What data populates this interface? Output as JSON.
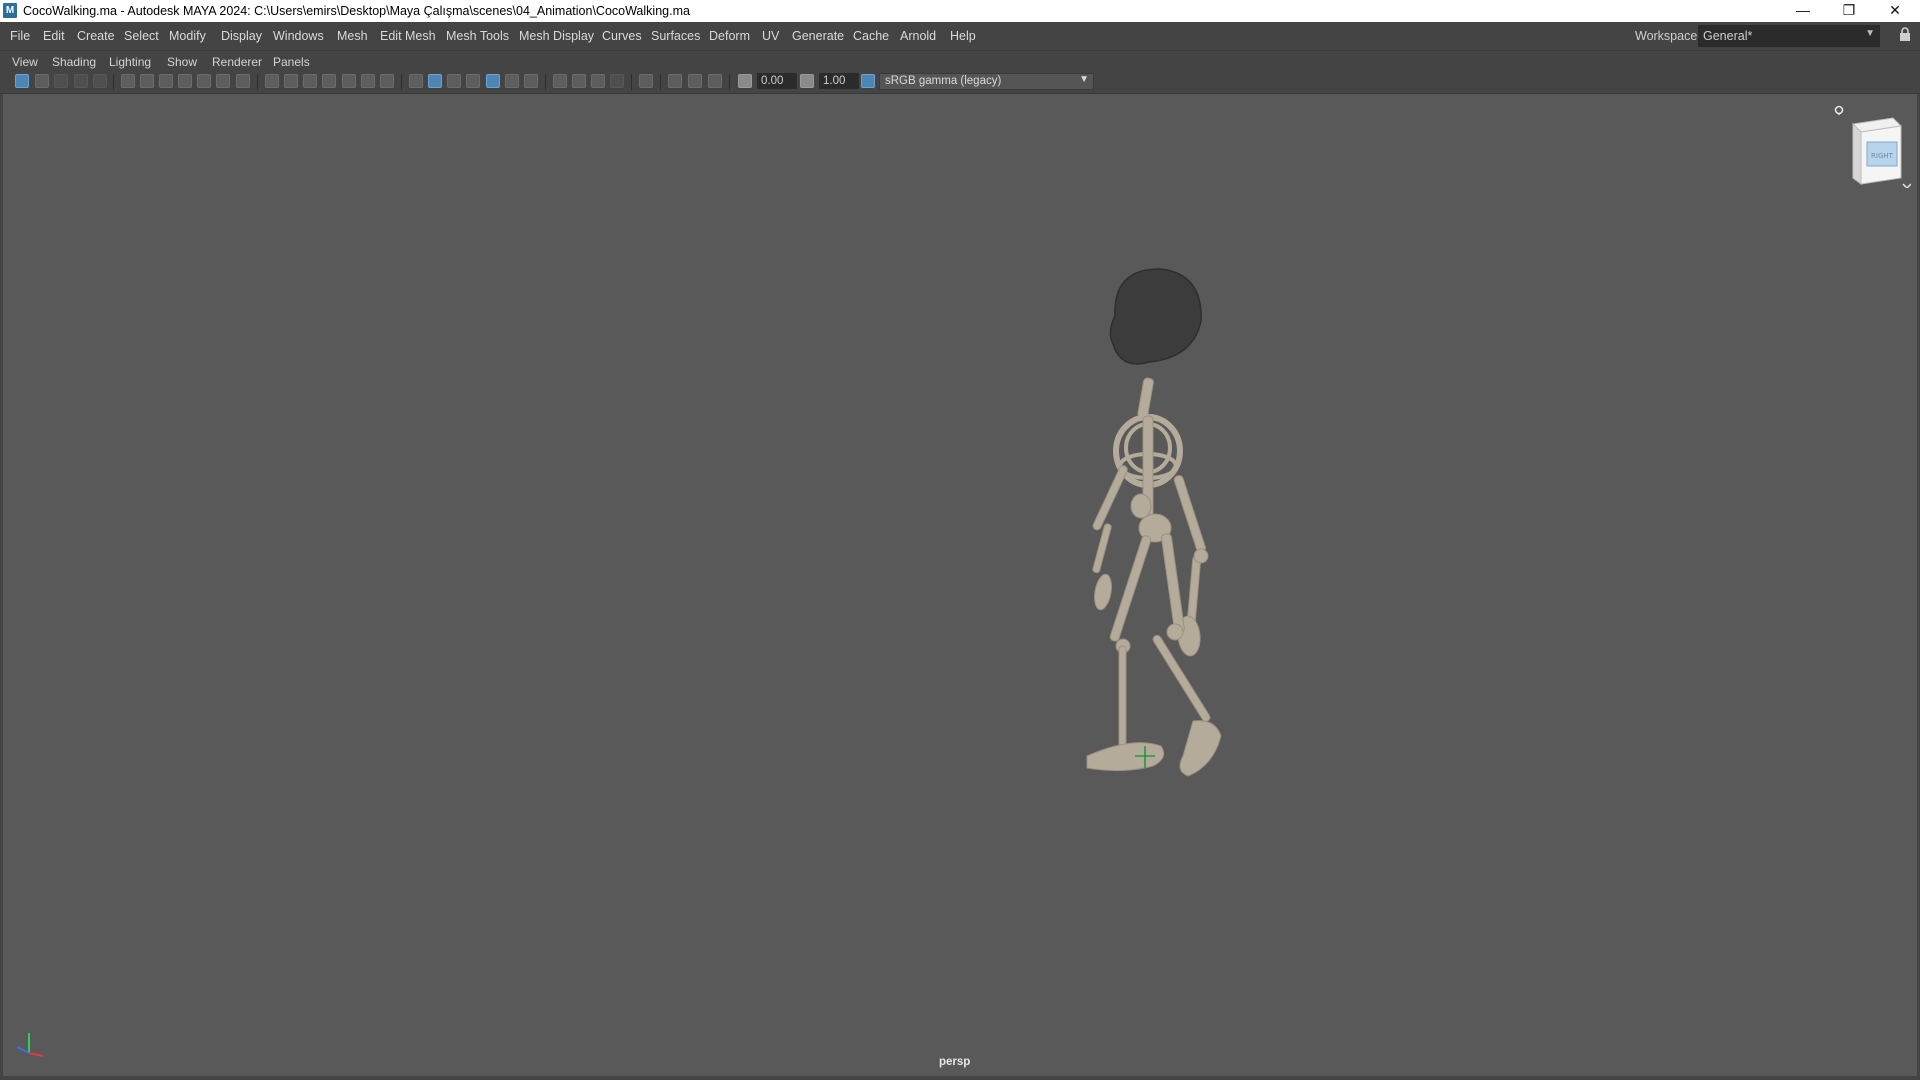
{
  "window": {
    "app_icon": "maya-app-icon",
    "title": "CocoWalking.ma - Autodesk MAYA 2024: C:\\Users\\emirs\\Desktop\\Maya Çalışma\\scenes\\04_Animation\\CocoWalking.ma",
    "controls": [
      "minimize-icon",
      "restore-icon",
      "close-icon"
    ]
  },
  "menubar": {
    "items": [
      "File",
      "Edit",
      "Create",
      "Select",
      "Modify",
      "Display",
      "Windows",
      "Mesh",
      "Edit Mesh",
      "Mesh Tools",
      "Mesh Display",
      "Curves",
      "Surfaces",
      "Deform",
      "UV",
      "Generate",
      "Cache",
      "Arnold",
      "Help"
    ],
    "workspace_label": "Workspace:",
    "workspace_value": "General*"
  },
  "panel_menu": {
    "items": [
      "View",
      "Shading",
      "Lighting",
      "Show",
      "Renderer",
      "Panels"
    ]
  },
  "toolbar": {
    "exposure": "0.00",
    "gamma": "1.00",
    "color_space": "sRGB gamma (legacy)"
  },
  "viewport": {
    "camera": "persp",
    "viewcube_face": "RIGHT",
    "background_color": "#595959",
    "skeleton_color": "#b5ab9b",
    "head_color": "#3c3c3c"
  }
}
